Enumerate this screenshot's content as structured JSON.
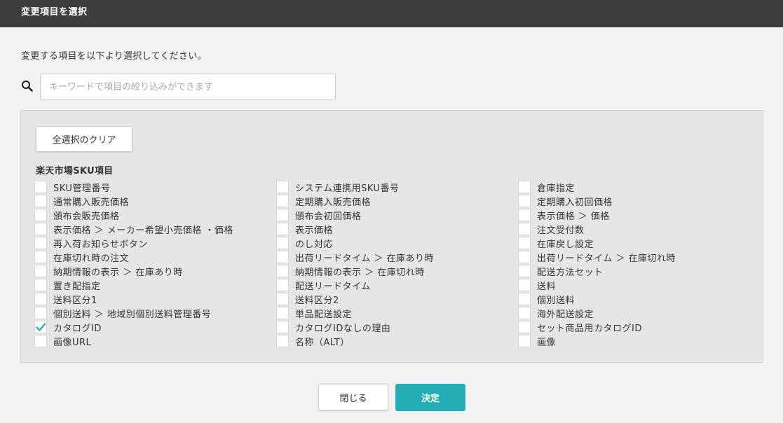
{
  "dialog": {
    "title": "変更項目を選択",
    "instruction": "変更する項目を以下より選択してください。"
  },
  "search": {
    "icon": "search-icon",
    "placeholder": "キーワードで項目の絞り込みができます",
    "value": ""
  },
  "panel": {
    "clear_label": "全選択のクリア",
    "group_heading": "楽天市場SKU項目"
  },
  "columns": [
    [
      {
        "label": "SKU管理番号",
        "checked": false
      },
      {
        "label": "通常購入販売価格",
        "checked": false
      },
      {
        "label": "頒布会販売価格",
        "checked": false
      },
      {
        "label": "表示価格 ＞ メーカー希望小売価格 ・価格",
        "checked": false
      },
      {
        "label": "再入荷お知らせボタン",
        "checked": false
      },
      {
        "label": "在庫切れ時の注文",
        "checked": false
      },
      {
        "label": "納期情報の表示 ＞ 在庫あり時",
        "checked": false
      },
      {
        "label": "置き配指定",
        "checked": false
      },
      {
        "label": "送料区分1",
        "checked": false
      },
      {
        "label": "個別送料 ＞ 地域別個別送料管理番号",
        "checked": false
      },
      {
        "label": "カタログID",
        "checked": true
      },
      {
        "label": "画像URL",
        "checked": false
      }
    ],
    [
      {
        "label": "システム連携用SKU番号",
        "checked": false
      },
      {
        "label": "定期購入販売価格",
        "checked": false
      },
      {
        "label": "頒布会初回価格",
        "checked": false
      },
      {
        "label": "表示価格",
        "checked": false
      },
      {
        "label": "のし対応",
        "checked": false
      },
      {
        "label": "出荷リードタイム ＞ 在庫あり時",
        "checked": false
      },
      {
        "label": "納期情報の表示 ＞ 在庫切れ時",
        "checked": false
      },
      {
        "label": "配送リードタイム",
        "checked": false
      },
      {
        "label": "送料区分2",
        "checked": false
      },
      {
        "label": "単品配送設定",
        "checked": false
      },
      {
        "label": "カタログIDなしの理由",
        "checked": false
      },
      {
        "label": "名称（ALT）",
        "checked": false
      }
    ],
    [
      {
        "label": "倉庫指定",
        "checked": false
      },
      {
        "label": "定期購入初回価格",
        "checked": false
      },
      {
        "label": "表示価格 ＞ 価格",
        "checked": false
      },
      {
        "label": "注文受付数",
        "checked": false
      },
      {
        "label": "在庫戻し設定",
        "checked": false
      },
      {
        "label": "出荷リードタイム ＞ 在庫切れ時",
        "checked": false
      },
      {
        "label": "配送方法セット",
        "checked": false
      },
      {
        "label": "送料",
        "checked": false
      },
      {
        "label": "個別送料",
        "checked": false
      },
      {
        "label": "海外配送設定",
        "checked": false
      },
      {
        "label": "セット商品用カタログID",
        "checked": false
      },
      {
        "label": "画像",
        "checked": false
      }
    ]
  ],
  "footer": {
    "close_label": "閉じる",
    "confirm_label": "決定"
  },
  "colors": {
    "titlebar": "#3d3d3d",
    "accent": "#24adb5",
    "check": "#24adb5"
  }
}
